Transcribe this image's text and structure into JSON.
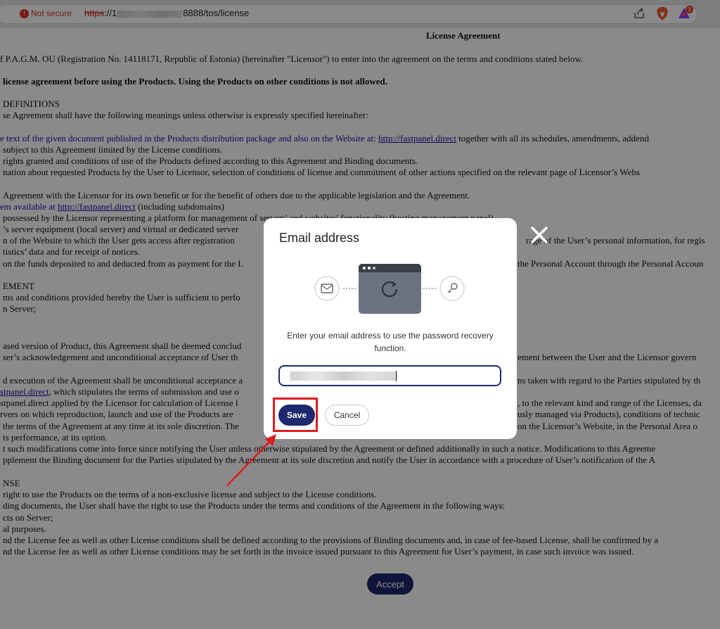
{
  "browser": {
    "security_label": "Not secure",
    "url_protocol": "https",
    "url_prefix": "://1",
    "url_suffix": "8888/tos/license",
    "extension_badge": "3"
  },
  "document": {
    "title": "License Agreement",
    "lines": [
      "f P.A.G.M. OU (Registration No. 14118171, Republic of Estonia) (hereinafter \"Licensor\") to enter into the agreement on the terms and conditions stated below.",
      "license agreement before using the Products. Using the Products on other conditions is not allowed.",
      "DEFINITIONS",
      "se Agreement shall have the following meanings unless otherwise is expressly specified hereinafter:",
      "e text of the given document published in the Products distribution package and also on the Website at:",
      "http://fastpanel.direct",
      "together with all its schedules, amendments, addend",
      "subject to this Agreement limited by the License conditions.",
      "rights granted and conditions of use of the Products defined according to this Agreement and Binding documents.",
      "nation about requested Products by the User to Licensor, selection of conditions of license and commitment of other actions specified on the relevant page of Licensor’s Webs",
      "Agreement with the Licensor for its own benefit or for the benefit of others due to the applicable legislation and the Agreement.",
      "em available at",
      "http://fastpanel.direct",
      "(including subdomains)",
      "possessed by the Licensor representing a platform for management of servers' and websites' functionality (hosting management panel).",
      "’s server equipment (local server) and virtual or dedicated server",
      "n of the Website to which the User gets access after registration",
      "rage of the User’s personal information, for regis",
      "tistics’ data and for receipt of notices.",
      "on the funds deposited to and deducted from as payment for the L",
      "the Personal Account through the Personal Accoun",
      "EMENT",
      "ms and conditions provided hereby the User is sufficient to perfo",
      "n Server;",
      "ased version of Product, this Agreement shall be deemed conclud",
      "ser’s acknowledgement and unconditional acceptance of User th",
      "ement between the User and the Licensor govern",
      "d execution of the Agreement shall be unconditional acceptance a",
      "ns taken with regard to the Parties stipulated by th",
      "stpanel.direct",
      ", which stipulates the terms of submission and use o",
      "stpanel.direct applied by the Licensor for calculation of License l",
      ", to the relevant kind and range of the Licenses, da",
      "rvers on which reproduction, launch and use of the Products are",
      "usly managed via Products), conditions of technic",
      "the terms of the Agreement at any time at its sole discretion. The",
      "on the Licensor’s Website, in the Personal Area o",
      "ts performance, at its option.",
      "t such modifications come into force since notifying the User unless otherwise stipulated by the Agreement or defined additionally in such a notice. Modifications to this Agreeme",
      "pplement the Binding document for the Parties stipulated by the Agreement at its sole discretion and notify the User in accordance with a procedure of User’s notification of the A",
      "NSE",
      "right to use the Products on the terms of a non-exclusive license and subject to the License conditions.",
      "ding documents, the User shall have the right to use the Products under the terms and conditions of the Agreement in the following ways:",
      "cts on Server;",
      "al purposes.",
      "nd the License fee as well as other License conditions shall be defined according to the provisions of Binding documents and, in case of fee-based License, shall be confirmed by a",
      "nd the License fee as well as other License conditions may be set forth in the invoice issued pursuant to this Agreement for User’s payment, in case such invoice was issued."
    ],
    "accept_label": "Accept"
  },
  "modal": {
    "title": "Email address",
    "description": "Enter your email address to use the password recovery function.",
    "save_label": "Save",
    "cancel_label": "Cancel"
  },
  "colors": {
    "primary": "#1d2a6d",
    "highlight": "#e01b1b",
    "link": "#1a0dab"
  }
}
